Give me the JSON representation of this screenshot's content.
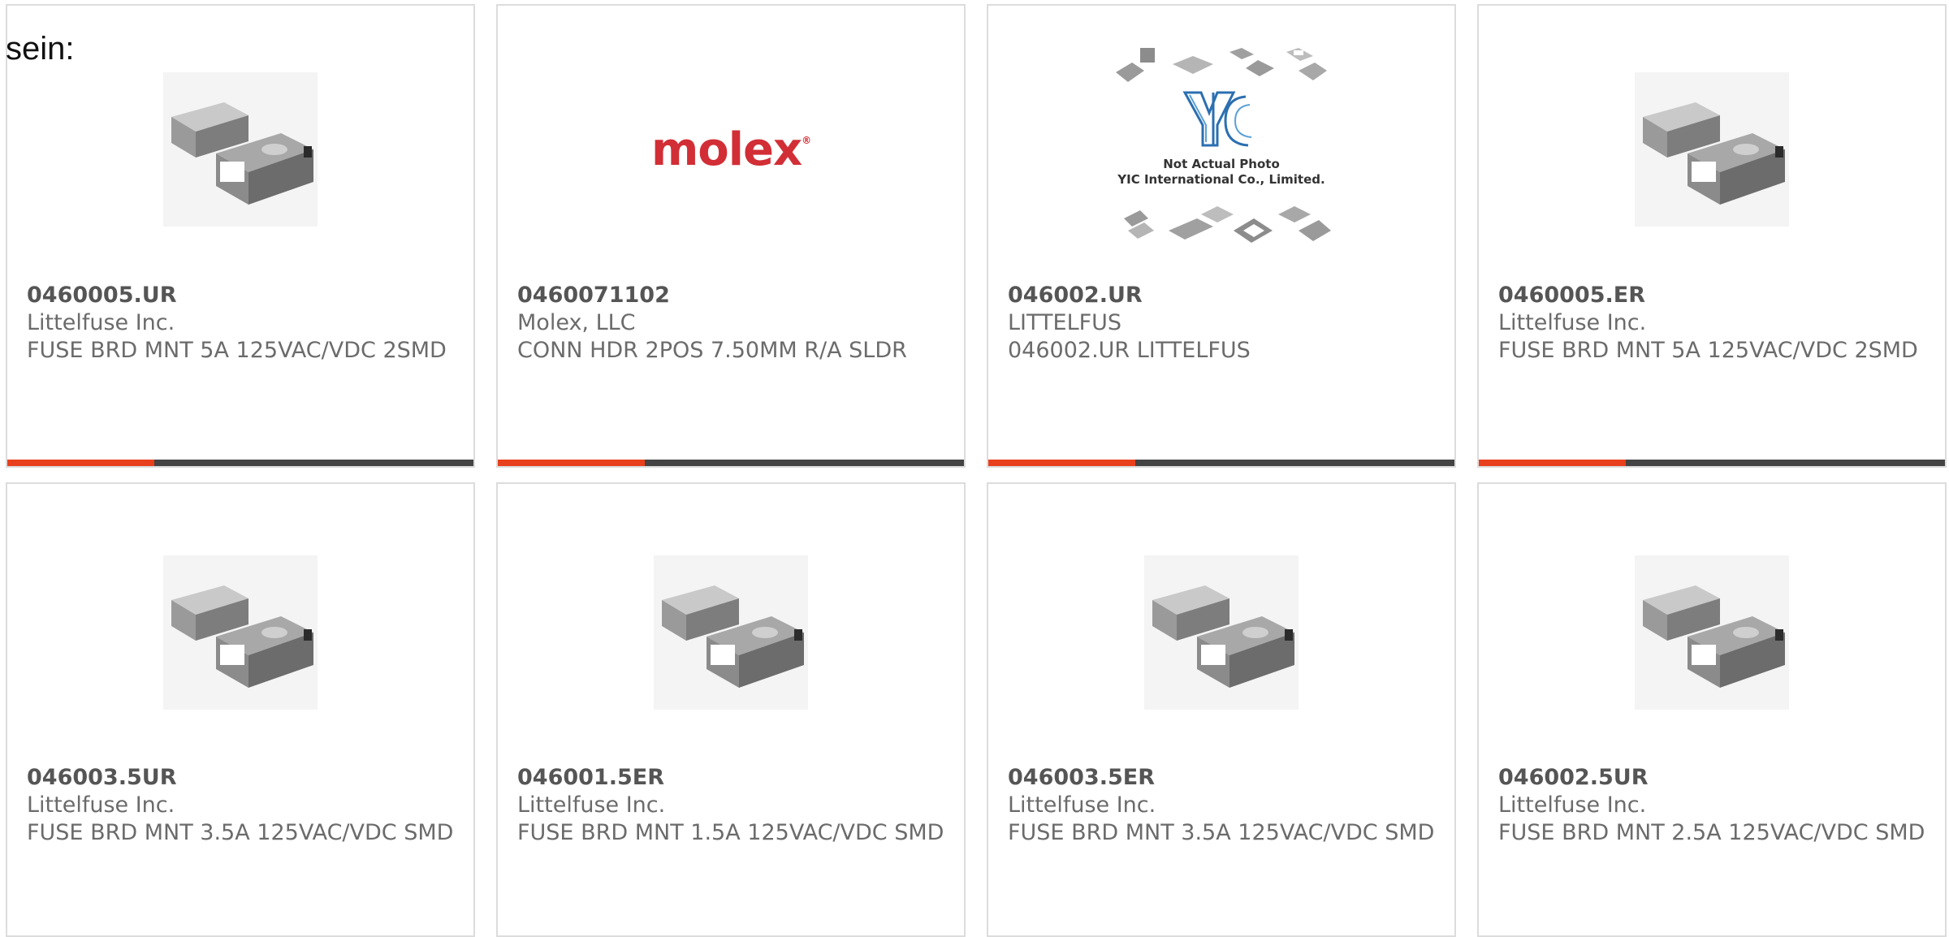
{
  "intro_text": "sein:",
  "accent_color": "#e8401c",
  "bar_color": "#444444",
  "products": [
    {
      "part": "0460005.UR",
      "manufacturer": "Littelfuse Inc.",
      "description": "FUSE BRD MNT 5A 125VAC/VDC 2SMD",
      "image": "smd-fuse-image"
    },
    {
      "part": "0460071102",
      "manufacturer": "Molex, LLC",
      "description": "CONN HDR 2POS 7.50MM R/A SLDR",
      "image": "molex-logo",
      "logo_text": "molex",
      "logo_mark": "®"
    },
    {
      "part": "046002.UR",
      "manufacturer": "LITTELFUS",
      "description": "046002.UR LITTELFUS",
      "image": "yic-placeholder-image",
      "image_caption_line1": "Not Actual Photo",
      "image_caption_line2": "YIC International Co., Limited."
    },
    {
      "part": "0460005.ER",
      "manufacturer": "Littelfuse Inc.",
      "description": "FUSE BRD MNT 5A 125VAC/VDC 2SMD",
      "image": "smd-fuse-image"
    },
    {
      "part": "046003.5UR",
      "manufacturer": "Littelfuse Inc.",
      "description": "FUSE BRD MNT 3.5A 125VAC/VDC SMD",
      "image": "smd-fuse-image"
    },
    {
      "part": "046001.5ER",
      "manufacturer": "Littelfuse Inc.",
      "description": "FUSE BRD MNT 1.5A 125VAC/VDC SMD",
      "image": "smd-fuse-image"
    },
    {
      "part": "046003.5ER",
      "manufacturer": "Littelfuse Inc.",
      "description": "FUSE BRD MNT 3.5A 125VAC/VDC SMD",
      "image": "smd-fuse-image"
    },
    {
      "part": "046002.5UR",
      "manufacturer": "Littelfuse Inc.",
      "description": "FUSE BRD MNT 2.5A 125VAC/VDC SMD",
      "image": "smd-fuse-image"
    }
  ]
}
